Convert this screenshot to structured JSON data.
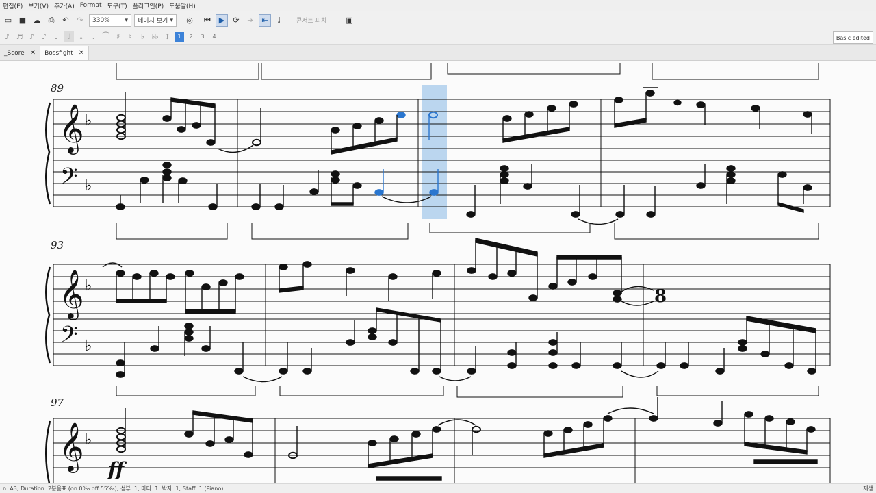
{
  "menu": [
    "편집(E)",
    "보기(V)",
    "추가(A)",
    "Format",
    "도구(T)",
    "플러그인(P)",
    "도움말(H)"
  ],
  "toolbar": {
    "zoom": "330%",
    "view_mode": "페이지 보기",
    "concert_pitch": "콘서트 피치"
  },
  "note_input": {
    "voices": [
      "1",
      "2",
      "3",
      "4"
    ],
    "workspace": "Basic edited"
  },
  "tabs": [
    {
      "label": "_Score"
    },
    {
      "label": "Bossfight"
    }
  ],
  "score": {
    "measure_numbers": [
      "89",
      "93",
      "97"
    ],
    "dynamic": "ff",
    "multimeasure_rest": "8"
  },
  "status": {
    "left": "n: A3; Duration: 2분음표  (on 0‰ off 55‰); 성부: 1;  마디: 1; 박자: 1; Staff: 1 (Piano)",
    "right": "재생"
  }
}
